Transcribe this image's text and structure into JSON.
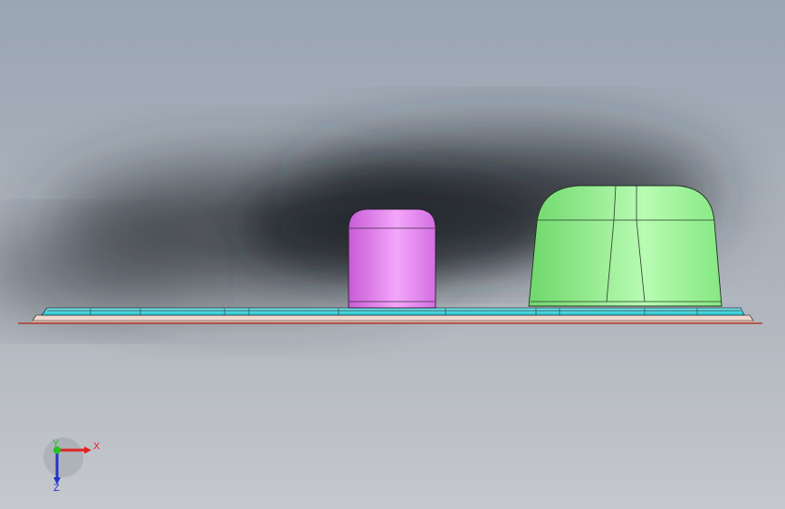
{
  "viewport": {
    "background_top": "#9aa4b2",
    "background_bottom": "#c4c8ce",
    "shadow_color": "#24272c"
  },
  "model": {
    "base_plate_color": "#40d8e0",
    "base_plate_edge": "#2a2f35",
    "bottom_strip_color": "#e6c9c0",
    "bottom_line_color": "#c0392b",
    "small_boss_color": "#e57af2",
    "large_boss_color": "#93f08e"
  },
  "triad": {
    "x_label": "X",
    "y_label": "Y",
    "z_label": "Z",
    "x_color": "#e12222",
    "y_color": "#22c322",
    "z_color": "#2233cc"
  }
}
